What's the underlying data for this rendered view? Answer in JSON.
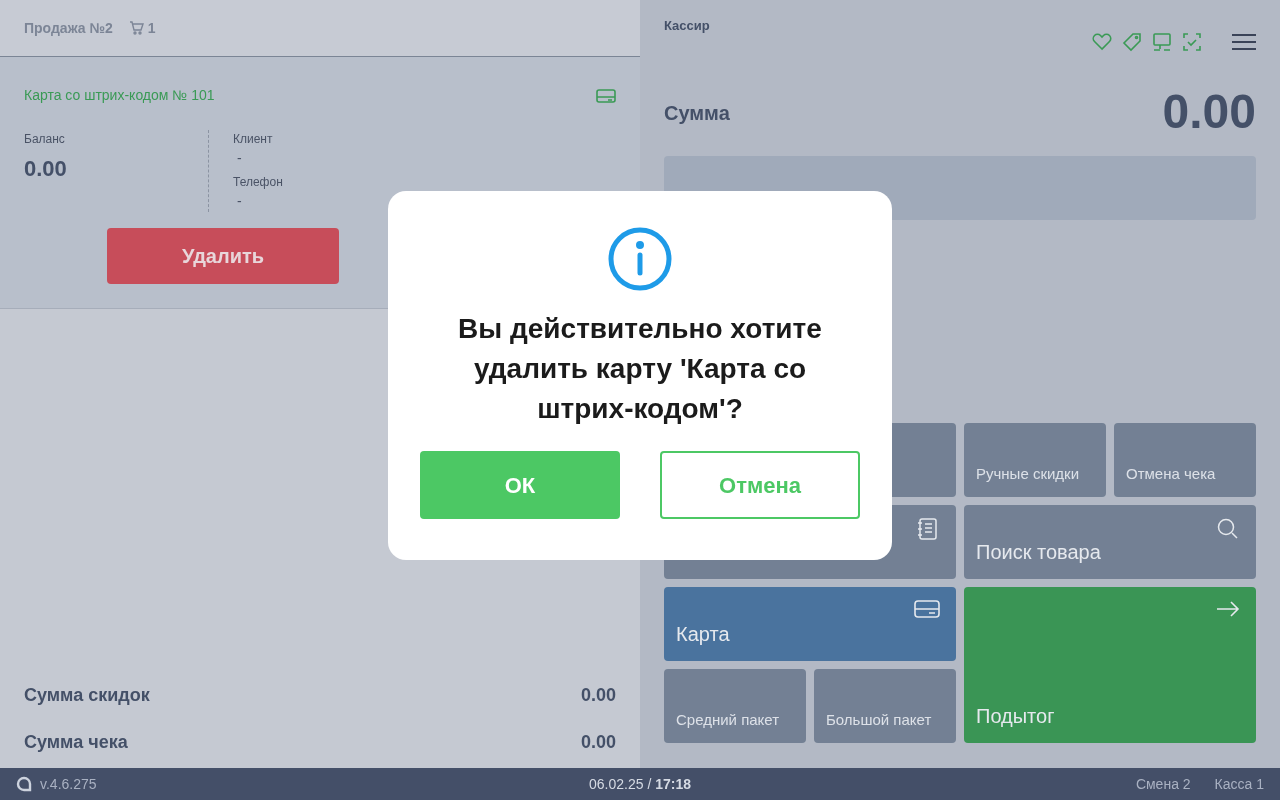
{
  "sale": {
    "title": "Продажа №2",
    "cart_count": "1"
  },
  "card": {
    "title": "Карта со штрих-кодом № 101",
    "balance_label": "Баланс",
    "balance": "0.00",
    "client_label": "Клиент",
    "client": "-",
    "phone_label": "Телефон",
    "phone": "-",
    "delete_button": "Удалить"
  },
  "totals": [
    {
      "label": "Сумма скидок",
      "value": "0.00"
    },
    {
      "label": "Сумма чека",
      "value": "0.00"
    }
  ],
  "cashier": "Кассир",
  "sum": {
    "label": "Сумма",
    "value": "0.00"
  },
  "tile_columns": [
    {
      "rows": [
        {
          "tiles": [
            {
              "kind": "plain",
              "color": "#738094"
            }
          ]
        },
        {
          "tiles": [
            {
              "kind": "catalog",
              "color": "#738094"
            }
          ]
        },
        {
          "tiles": [
            {
              "kind": "card",
              "color": "#4a739e",
              "label": "Карта"
            }
          ]
        },
        {
          "tiles": [
            {
              "kind": "plain",
              "color": "#738094",
              "label": "Средний пакет"
            },
            {
              "kind": "plain",
              "color": "#738094",
              "label": "Большой пакет"
            }
          ]
        }
      ]
    },
    {
      "rows": [
        {
          "tiles": [
            {
              "kind": "plain",
              "color": "#738094",
              "label": "Ручные скидки"
            },
            {
              "kind": "plain",
              "color": "#738094",
              "label": "Отмена чека"
            }
          ]
        },
        {
          "tiles": [
            {
              "kind": "search",
              "color": "#738094",
              "label": "Поиск товара"
            }
          ]
        },
        {
          "tiles": [
            {
              "kind": "subtotal",
              "color": "#3a9555",
              "label": "Подытог"
            }
          ]
        }
      ]
    }
  ],
  "status_bar": {
    "version": "v.4.6.275",
    "datetime": "06.02.25 / **17:18**",
    "shift": "Смена 2",
    "register": "Касса 1"
  },
  "dialog": {
    "message": "Вы действительно хотите удалить карту 'Карта со штрих-кодом'?",
    "ok": "ОК",
    "cancel": "Отмена"
  }
}
